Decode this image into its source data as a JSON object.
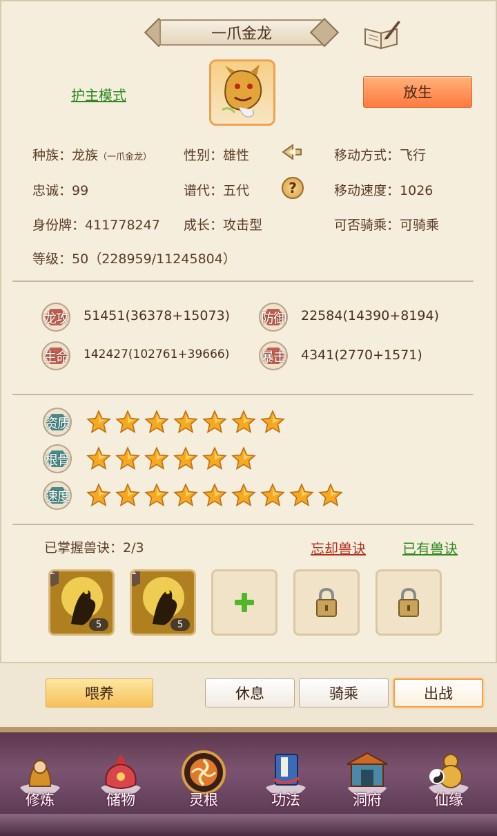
{
  "title": "一爪金龙",
  "guard_mode": "护主模式",
  "release_button": "放生",
  "info": {
    "race_label": "种族：",
    "race_value": "龙族",
    "race_sub": "（一爪金龙）",
    "gender_label": "性别：",
    "gender_value": "雄性",
    "move_label": "移动方式：",
    "move_value": "飞行",
    "loyalty_label": "忠诚：",
    "loyalty_value": "99",
    "generation_label": "谱代：",
    "generation_value": "五代",
    "speed_label": "移动速度：",
    "speed_value": "1026",
    "id_label": "身份牌：",
    "id_value": "411778247",
    "growth_label": "成长：",
    "growth_value": "攻击型",
    "ride_label": "可否骑乘：",
    "ride_value": "可骑乘",
    "level_label": "等级：",
    "level_value": "50（228959/11245804）"
  },
  "stats": [
    {
      "label": "龙攻",
      "value": "51451(36378+15073)"
    },
    {
      "label": "防御",
      "value": "22584(14390+8194)"
    },
    {
      "label": "生命",
      "value": "142427(102761+39666)"
    },
    {
      "label": "暴击",
      "value": "4341(2770+1571)"
    }
  ],
  "aptitudes": [
    {
      "label": "资质",
      "stars": 7
    },
    {
      "label": "根骨",
      "stars": 6
    },
    {
      "label": "速度",
      "stars": 9
    }
  ],
  "skills_section": {
    "mastered": "已掌握兽诀：2/3",
    "forget": "忘却兽诀",
    "owned": "已有兽诀",
    "slots": [
      {
        "rank": "2",
        "level": "5"
      },
      {
        "rank": "1",
        "level": "5"
      }
    ]
  },
  "actions": {
    "feed": "喂养",
    "rest": "休息",
    "ride": "骑乘",
    "battle": "出战"
  },
  "nav": [
    "修炼",
    "储物",
    "灵根",
    "功法",
    "洞府",
    "仙缘"
  ],
  "colors": {
    "accent": "#ff7a40",
    "green_link": "#2d8a1f",
    "red_link": "#b2301d"
  }
}
